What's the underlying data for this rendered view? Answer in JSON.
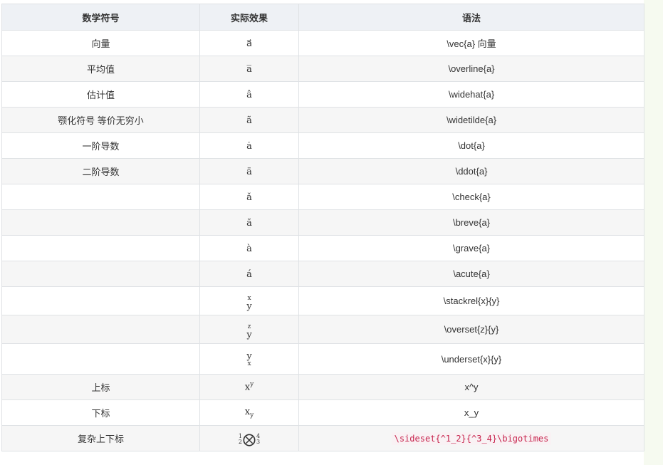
{
  "table": {
    "headers": [
      "数学符号",
      "实际效果",
      "语法"
    ],
    "rows": [
      {
        "name": "向量",
        "effect": "a⃗",
        "syntax": "\\vec{a} 向量"
      },
      {
        "name": "平均值",
        "effect": "a̅",
        "syntax": "\\overline{a}"
      },
      {
        "name": "估计值",
        "effect": "â",
        "syntax": "\\widehat{a}"
      },
      {
        "name": "颚化符号 等价无穷小",
        "effect": "ã",
        "syntax": "\\widetilde{a}"
      },
      {
        "name": "一阶导数",
        "effect": "ȧ",
        "syntax": "\\dot{a}"
      },
      {
        "name": "二阶导数",
        "effect": "ä",
        "syntax": "\\ddot{a}"
      },
      {
        "name": "",
        "effect": "ǎ",
        "syntax": "\\check{a}"
      },
      {
        "name": "",
        "effect": "ă",
        "syntax": "\\breve{a}"
      },
      {
        "name": "",
        "effect": "à",
        "syntax": "\\grave{a}"
      },
      {
        "name": "",
        "effect": "á",
        "syntax": "\\acute{a}"
      },
      {
        "name": "",
        "effect_top": "x",
        "effect_main": "y",
        "syntax": "\\stackrel{x}{y}"
      },
      {
        "name": "",
        "effect_top": "z",
        "effect_main": "y",
        "syntax": "\\overset{z}{y}"
      },
      {
        "name": "",
        "effect_main": "y",
        "effect_bottom": "x",
        "syntax": "\\underset{x}{y}"
      },
      {
        "name": "上标",
        "effect_base": "x",
        "effect_sup": "y",
        "syntax": "x^y"
      },
      {
        "name": "下标",
        "effect_base": "x",
        "effect_sub": "y",
        "syntax": "x_y"
      },
      {
        "name": "复杂上下标",
        "left_sup": "1",
        "left_sub": "2",
        "op": "⨂",
        "right_sup": "4",
        "right_sub": "3",
        "syntax": "\\sideset{^1_2}{^3_4}\\bigotimes"
      }
    ]
  }
}
